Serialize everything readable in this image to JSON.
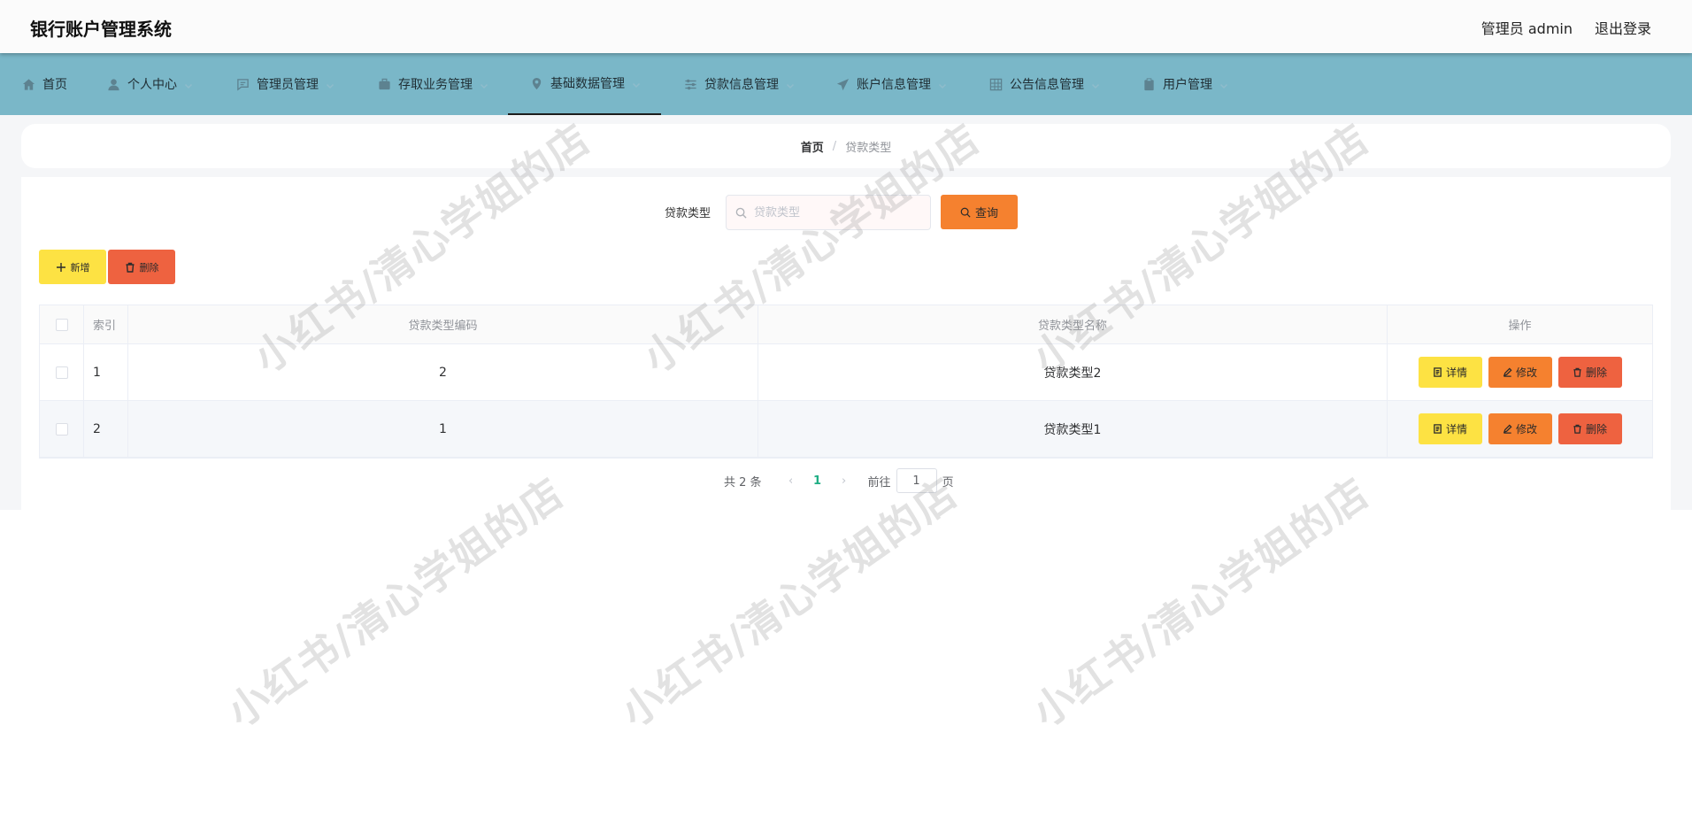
{
  "app": {
    "title": "银行账户管理系统"
  },
  "header": {
    "user_label": "管理员 admin",
    "logout_label": "退出登录"
  },
  "nav": {
    "items": [
      {
        "label": "首页",
        "icon": "home-icon"
      },
      {
        "label": "个人中心",
        "icon": "user-icon"
      },
      {
        "label": "管理员管理",
        "icon": "chat-icon"
      },
      {
        "label": "存取业务管理",
        "icon": "suitcase-icon"
      },
      {
        "label": "基础数据管理",
        "icon": "location-icon"
      },
      {
        "label": "贷款信息管理",
        "icon": "sliders-icon"
      },
      {
        "label": "账户信息管理",
        "icon": "send-icon"
      },
      {
        "label": "公告信息管理",
        "icon": "grid-icon"
      },
      {
        "label": "用户管理",
        "icon": "clipboard-icon"
      }
    ],
    "active_index": 4
  },
  "breadcrumb": {
    "home": "首页",
    "separator": "/",
    "current": "贷款类型"
  },
  "search": {
    "label": "贷款类型",
    "placeholder": "贷款类型",
    "value": "",
    "button_label": "查询"
  },
  "toolbar": {
    "add_label": "新增",
    "delete_label": "删除"
  },
  "table": {
    "columns": [
      "索引",
      "贷款类型编码",
      "贷款类型名称",
      "操作"
    ],
    "rows": [
      {
        "index": "1",
        "code": "2",
        "name": "贷款类型2"
      },
      {
        "index": "2",
        "code": "1",
        "name": "贷款类型1"
      }
    ],
    "actions": {
      "detail": "详情",
      "edit": "修改",
      "delete": "删除"
    }
  },
  "pagination": {
    "total_text": "共 2 条",
    "prev": "‹",
    "current_page": "1",
    "next": "›",
    "goto_label": "前往",
    "goto_value": "1",
    "page_suffix": "页"
  },
  "watermark": {
    "text": "小红书/清心学姐的店"
  },
  "colors": {
    "header_bg": "#fbfbfb",
    "nav_bg": "#7ab7c8",
    "page_bg": "#f5f6f8",
    "yellow": "#fde243",
    "orange": "#f5812f",
    "red": "#ee6240",
    "active_page": "#1fae84"
  }
}
